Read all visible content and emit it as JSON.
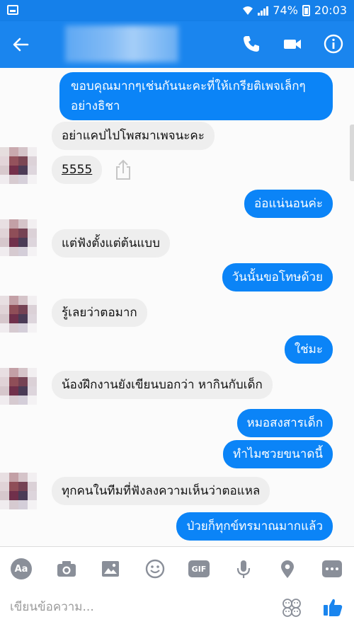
{
  "status_bar": {
    "battery": "74%",
    "time": "20:03"
  },
  "header": {
    "back_icon": "arrow-back-icon",
    "contact_name": "",
    "actions": [
      "phone-icon",
      "video-icon",
      "info-icon"
    ]
  },
  "messages": [
    {
      "dir": "out",
      "lines": [
        "ขอบคุณมากๆเช่นกันนะคะที่ให้เกรียติเพจเล็กๆ",
        "อย่างธิชา"
      ]
    },
    {
      "dir": "in",
      "text": "อย่าแคปไปโพสมาเพจนะคะ"
    },
    {
      "dir": "in",
      "text": "5555"
    },
    {
      "dir": "out",
      "text": "อ่อแน่นอนค่ะ"
    },
    {
      "dir": "in",
      "text": "แต่ฟังตั้งแต่ต้นแบบ"
    },
    {
      "dir": "out",
      "text": "วันนั้นขอโทษด้วย"
    },
    {
      "dir": "in",
      "text": "รู้เลยว่าตอมาก"
    },
    {
      "dir": "out",
      "text": "ใช่มะ"
    },
    {
      "dir": "in",
      "text": "น้องฝึกงานยังเขียนบอกว่า หากินกับเด็ก"
    },
    {
      "dir": "out",
      "text": "หมอสงสารเด็ก"
    },
    {
      "dir": "out",
      "text": "ทำไมซวยขนาดนี้"
    },
    {
      "dir": "in",
      "text": "ทุกคนในทีมที่ฟังลงความเห็นว่าตอแหล"
    },
    {
      "dir": "out",
      "text": "ป่วยก็ทุกข์ทรมาณมากแล้ว"
    }
  ],
  "toolbar": {
    "icons": [
      "text-style-icon",
      "camera-icon",
      "image-icon",
      "emoji-icon",
      "gif-icon",
      "microphone-icon",
      "location-icon",
      "more-icon"
    ],
    "aa_label": "Aa",
    "gif_label": "GIF",
    "input_placeholder": "เขียนข้อความ...",
    "emoji_button": "emoji-picker-icon",
    "like_button": "thumbs-up-icon"
  },
  "colors": {
    "accent": "#1a85ee",
    "outgoing_bubble": "#0b84f7",
    "incoming_bubble": "#eeeeee",
    "icon_gray": "#8a8f99"
  }
}
